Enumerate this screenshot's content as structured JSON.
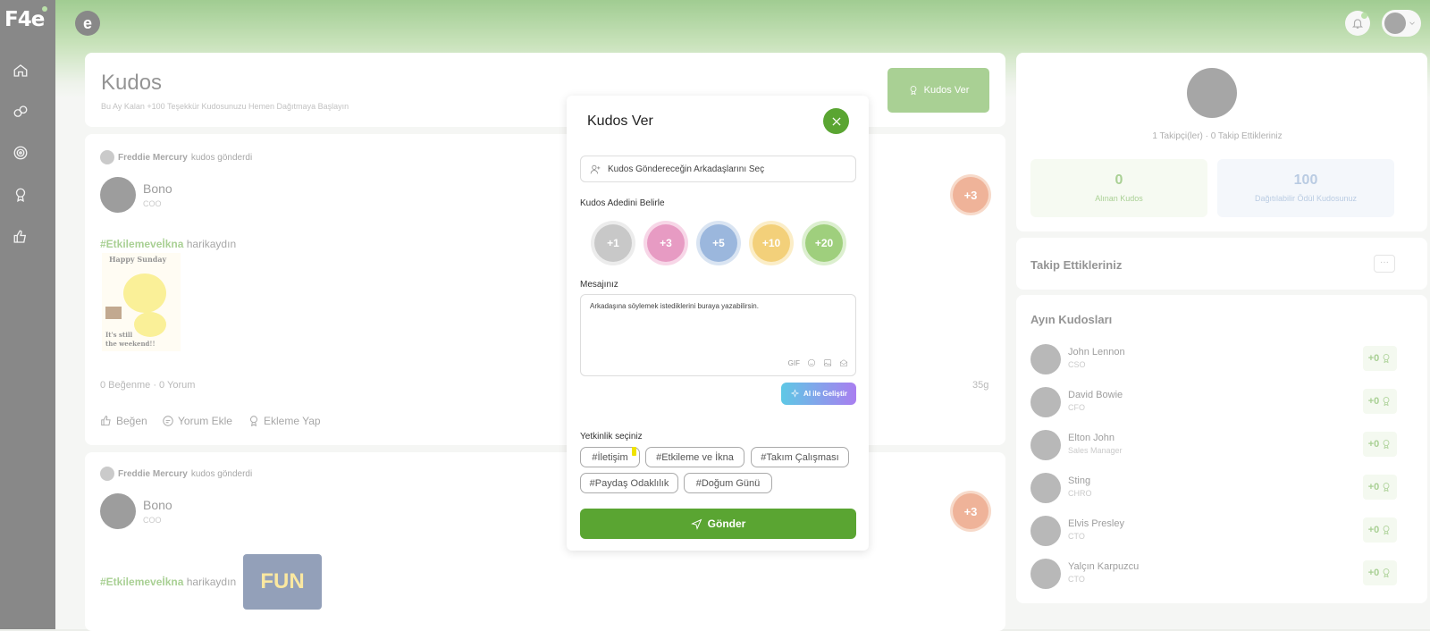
{
  "sidebar": {
    "logo": "F4e",
    "nav": [
      "home-icon",
      "social-icon",
      "target-icon",
      "kudos-icon",
      "thumbs-up-icon"
    ]
  },
  "topbar": {
    "brand": "e"
  },
  "header": {
    "title": "Kudos",
    "subtitle": "Bu Ay Kalan +100 Teşekkür Kudosunuzu Hemen Dağıtmaya Başlayın",
    "kudos_button": "Kudos Ver"
  },
  "feed": [
    {
      "sender": "Freddie Mercury",
      "action": "kudos gönderdi",
      "recipient": "Bono",
      "role": "COO",
      "amount": "+3",
      "hashtag": "#Etkilemeveİkna",
      "text": "harikaydın",
      "stats": "0 Beğenme · 0 Yorum",
      "ago": "35g",
      "actions": [
        "Beğen",
        "Yorum Ekle",
        "Ekleme Yap"
      ]
    },
    {
      "sender": "Freddie Mercury",
      "action": "kudos gönderdi",
      "recipient": "Bono",
      "role": "COO",
      "amount": "+3",
      "hashtag": "#Etkilemeveİkna",
      "text": "harikaydın",
      "image_text": "FUN"
    }
  ],
  "profile": {
    "followers": "1 Takipçi(ler) · 0 Takip Ettikleriniz",
    "received": "0",
    "received_label": "Alınan Kudos",
    "distributable": "100",
    "distributable_label": "Dağıtılabilir Ödül Kudosunuz"
  },
  "following": {
    "title": "Takip Ettikleriniz",
    "more": "···"
  },
  "monthly": {
    "title": "Ayın Kudosları",
    "items": [
      {
        "name": "John Lennon",
        "role": "CSO",
        "score": "+0"
      },
      {
        "name": "David Bowie",
        "role": "CFO",
        "score": "+0"
      },
      {
        "name": "Elton John",
        "role": "Sales Manager",
        "score": "+0"
      },
      {
        "name": "Sting",
        "role": "CHRO",
        "score": "+0"
      },
      {
        "name": "Elvis Presley",
        "role": "CTO",
        "score": "+0"
      },
      {
        "name": "Yalçın Karpuzcu",
        "role": "CTO",
        "score": "+0"
      }
    ]
  },
  "modal": {
    "title": "Kudos Ver",
    "recipient_placeholder": "Kudos Göndereceğin Arkadaşlarını Seç",
    "amount_label": "Kudos Adedini Belirle",
    "amounts": [
      {
        "value": "+1",
        "color": "#c8c8c8"
      },
      {
        "value": "+3",
        "color": "#e79bc3"
      },
      {
        "value": "+5",
        "color": "#9bb7dd"
      },
      {
        "value": "+10",
        "color": "#f3d07a"
      },
      {
        "value": "+20",
        "color": "#9fcf7d"
      }
    ],
    "message_label": "Mesajınız",
    "message_placeholder": "Arkadaşına söylemek istediklerini buraya yazabilirsin.",
    "gif_label": "GIF",
    "ai_button": "AI ile Geliştir",
    "competency_label": "Yetkinlik seçiniz",
    "competencies": [
      "İletişim",
      "Etkileme ve İkna",
      "Takım Çalışması",
      "Paydaş Odaklılık",
      "Doğum Günü"
    ],
    "send_button": "Gönder"
  },
  "colors": {
    "accent": "#5aa532",
    "kudos_badge": "#e06d3d"
  }
}
